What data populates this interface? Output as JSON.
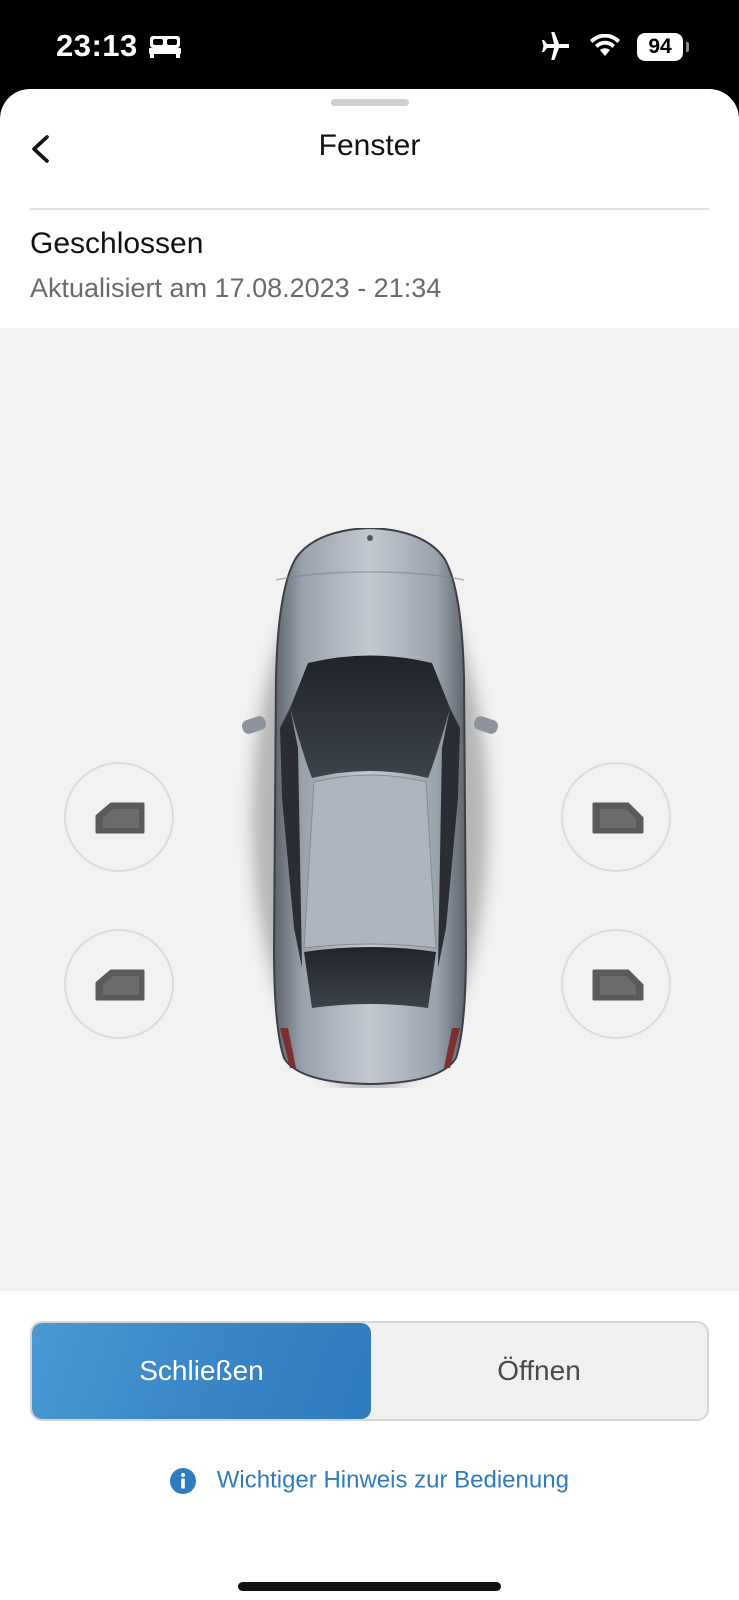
{
  "status_bar": {
    "time": "23:13",
    "battery": "94",
    "icons": [
      "bed-icon",
      "airplane-icon",
      "wifi-icon",
      "battery-icon"
    ]
  },
  "header": {
    "title": "Fenster",
    "back_icon": "chevron-left-icon"
  },
  "status": {
    "title": "Geschlossen",
    "updated": "Aktualisiert am 17.08.2023 - 21:34"
  },
  "windows": {
    "icons": [
      "window-front-left-icon",
      "window-rear-left-icon",
      "window-front-right-icon",
      "window-rear-right-icon"
    ]
  },
  "controls": {
    "close_label": "Schließen",
    "open_label": "Öffnen",
    "selected": "Schließen"
  },
  "hint": {
    "label": "Wichtiger Hinweis zur Bedienung",
    "icon": "info-icon"
  },
  "colors": {
    "accent": "#3a86c7",
    "background": "#f2f2f2"
  }
}
